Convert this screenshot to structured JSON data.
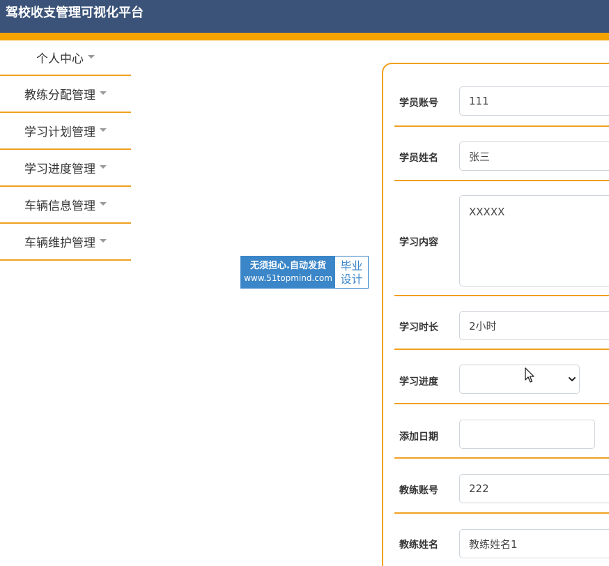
{
  "header": {
    "title": "驾校收支管理可视化平台"
  },
  "sidebar": {
    "items": [
      {
        "label": "个人中心"
      },
      {
        "label": "教练分配管理"
      },
      {
        "label": "学习计划管理"
      },
      {
        "label": "学习进度管理"
      },
      {
        "label": "车辆信息管理"
      },
      {
        "label": "车辆维护管理"
      }
    ]
  },
  "watermark": {
    "line1": "无须担心.自动发货",
    "line2": "www.51topmind.com",
    "right1": "毕业",
    "right2": "设计"
  },
  "form": {
    "student_account": {
      "label": "学员账号",
      "value": "111"
    },
    "student_name": {
      "label": "学员姓名",
      "value": "张三"
    },
    "study_content": {
      "label": "学习内容",
      "value": "XXXXX"
    },
    "study_duration": {
      "label": "学习时长",
      "value": "2小时"
    },
    "study_progress": {
      "label": "学习进度",
      "value": ""
    },
    "add_date": {
      "label": "添加日期",
      "value": ""
    },
    "coach_account": {
      "label": "教练账号",
      "value": "222"
    },
    "coach_name": {
      "label": "教练姓名",
      "value": "教练姓名1"
    }
  },
  "colors": {
    "header": "#3b5378",
    "accent": "#f5a300",
    "watermark": "#3a86c8"
  }
}
